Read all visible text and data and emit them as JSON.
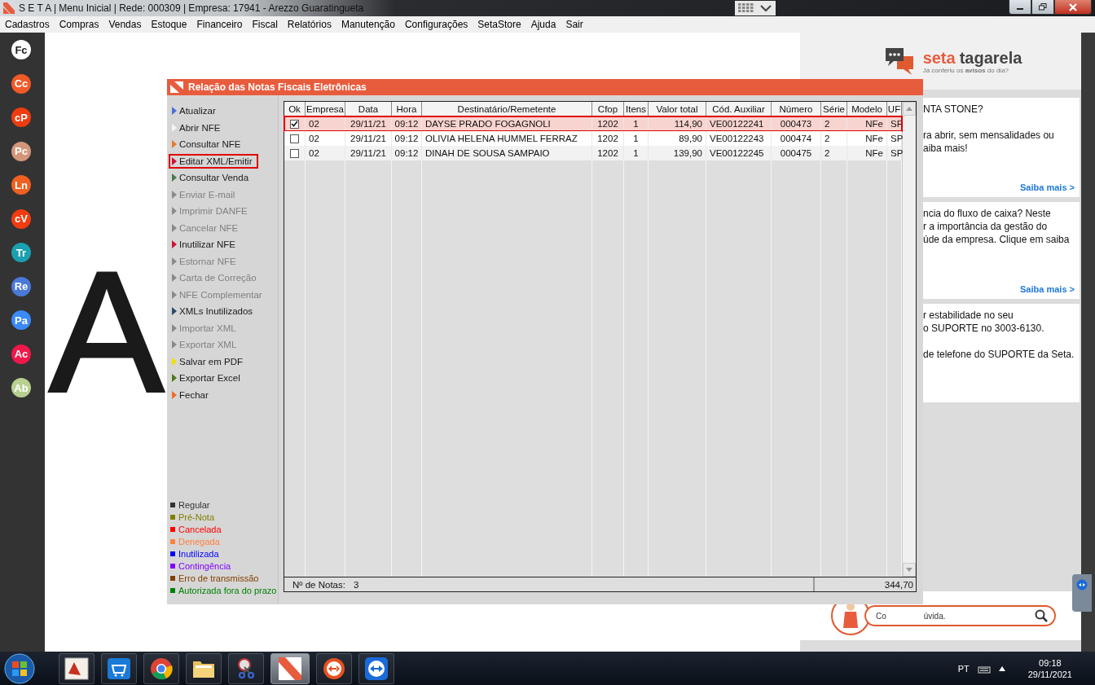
{
  "window": {
    "title": "S E T A | Menu Inicial | Rede: 000309 | Empresa: 17941 - Arezzo Guaratingueta"
  },
  "menu": [
    "Cadastros",
    "Compras",
    "Vendas",
    "Estoque",
    "Financeiro",
    "Fiscal",
    "Relatórios",
    "Manutenção",
    "Configurações",
    "SetaStore",
    "Ajuda",
    "Sair"
  ],
  "sidebar": {
    "items": [
      {
        "label": "Fc",
        "color": "#ffffff"
      },
      {
        "label": "Cc",
        "color": "#f05a28"
      },
      {
        "label": "cP",
        "color": "#f03c10"
      },
      {
        "label": "Pc",
        "color": "#d4967a"
      },
      {
        "label": "Ln",
        "color": "#f06020"
      },
      {
        "label": "cV",
        "color": "#f03c10"
      },
      {
        "label": "Tr",
        "color": "#1aa0b0"
      },
      {
        "label": "Re",
        "color": "#4a7ad8"
      },
      {
        "label": "Pa",
        "color": "#3a8af8"
      },
      {
        "label": "Ac",
        "color": "#f0184a"
      },
      {
        "label": "Ab",
        "color": "#b8d090"
      }
    ]
  },
  "background_logo": "A",
  "news": {
    "brand": "seta",
    "name": "tagarela",
    "tagline": "Já conferiu os **avisos** do dia?",
    "cards": [
      {
        "paragraphs": [
          [
            "NTA STONE?"
          ],
          [
            "ra abrir, sem mensalidades ou",
            "aiba mais!"
          ]
        ],
        "link": "Saiba mais >"
      },
      {
        "paragraphs": [
          [
            "ncia do fluxo de caixa?  Neste",
            "r a importância da gestão do",
            "úde da empresa. Clique em saiba"
          ]
        ],
        "link": "Saiba mais >"
      },
      {
        "paragraphs": [
          [
            "r estabilidade no seu",
            "o SUPORTE no 3003-6130."
          ],
          [
            "de telefone do SUPORTE da Seta."
          ]
        ]
      }
    ]
  },
  "help_search": {
    "text_start": "Co",
    "text_end": "úvida."
  },
  "dialog": {
    "title": "Relação das Notas Fiscais Eletrônicas",
    "actions": [
      {
        "label": "Atualizar",
        "color": "#4a6fd8",
        "disabled": false,
        "highlighted": false
      },
      {
        "label": "Abrir NFE",
        "color": "#f4f4f4",
        "disabled": false,
        "highlighted": false
      },
      {
        "label": "Consultar NFE",
        "color": "#e87a2c",
        "disabled": false,
        "highlighted": false
      },
      {
        "label": "Editar XML/Emitir",
        "color": "#d0103a",
        "disabled": false,
        "highlighted": true
      },
      {
        "label": "Consultar Venda",
        "color": "#4a7a4a",
        "disabled": false,
        "highlighted": false
      },
      {
        "label": "Enviar E-mail",
        "color": "#8a8a8a",
        "disabled": true,
        "highlighted": false
      },
      {
        "label": "Imprimir DANFE",
        "color": "#8a8a8a",
        "disabled": true,
        "highlighted": false
      },
      {
        "label": "Cancelar NFE",
        "color": "#8a8a8a",
        "disabled": true,
        "highlighted": false
      },
      {
        "label": "Inutilizar NFE",
        "color": "#d0103a",
        "disabled": false,
        "highlighted": false
      },
      {
        "label": "Estornar NFE",
        "color": "#8a8a8a",
        "disabled": true,
        "highlighted": false
      },
      {
        "label": "Carta de Correção",
        "color": "#8a8a8a",
        "disabled": true,
        "highlighted": false
      },
      {
        "label": "NFE Complementar",
        "color": "#8a8a8a",
        "disabled": true,
        "highlighted": false
      },
      {
        "label": "XMLs Inutilizados",
        "color": "#2c4a6a",
        "disabled": false,
        "highlighted": false
      },
      {
        "label": "Importar XML",
        "color": "#8a8a8a",
        "disabled": true,
        "highlighted": false
      },
      {
        "label": "Exportar XML",
        "color": "#8a8a8a",
        "disabled": true,
        "highlighted": false
      },
      {
        "label": "Salvar em PDF",
        "color": "#f0e000",
        "disabled": false,
        "highlighted": false
      },
      {
        "label": "Exportar Excel",
        "color": "#4a7a1a",
        "disabled": false,
        "highlighted": false
      },
      {
        "label": "Fechar",
        "color": "#f06a2a",
        "disabled": false,
        "highlighted": false
      }
    ],
    "legend": [
      {
        "label": "Regular",
        "color": "#333333"
      },
      {
        "label": "Pré-Nota",
        "color": "#808000"
      },
      {
        "label": "Cancelada",
        "color": "#ff0000"
      },
      {
        "label": "Denegada",
        "color": "#ff8040"
      },
      {
        "label": "Inutilizada",
        "color": "#0000ff"
      },
      {
        "label": "Contingência",
        "color": "#8000ff"
      },
      {
        "label": "Erro de transmissão",
        "color": "#804000"
      },
      {
        "label": "Autorizada fora do prazo",
        "color": "#008000"
      }
    ],
    "table": {
      "check_column": "Ok",
      "columns": [
        "Empresa",
        "Data",
        "Hora",
        "Destinatário/Remetente",
        "Cfop",
        "Itens",
        "Valor total",
        "Cód. Auxiliar",
        "Número",
        "Série",
        "Modelo",
        "UF"
      ],
      "rows": [
        {
          "checked": true,
          "selected": true,
          "cells": [
            "02",
            "29/11/21",
            "09:12",
            "DAYSE PRADO FOGAGNOLI",
            "1202",
            "1",
            "114,90",
            "VE00122241",
            "000473",
            "2",
            "NFe",
            "SP"
          ]
        },
        {
          "checked": false,
          "selected": false,
          "cells": [
            "02",
            "29/11/21",
            "09:12",
            "OLIVIA HELENA HUMMEL FERRAZ",
            "1202",
            "1",
            "89,90",
            "VE00122243",
            "000474",
            "2",
            "NFe",
            "SP"
          ]
        },
        {
          "checked": false,
          "selected": false,
          "cells": [
            "02",
            "29/11/21",
            "09:12",
            "DINAH DE SOUSA SAMPAIO",
            "1202",
            "1",
            "139,90",
            "VE00122245",
            "000475",
            "2",
            "NFe",
            "SP"
          ]
        }
      ]
    },
    "footer": {
      "count_label": "Nº de Notas:",
      "count": "3",
      "total": "344,70"
    }
  },
  "taskbar": {
    "items": [
      {
        "kind": "app3c",
        "active": false
      },
      {
        "kind": "basket",
        "active": false
      },
      {
        "kind": "chrome",
        "active": false
      },
      {
        "kind": "folder",
        "active": false
      },
      {
        "kind": "scissors",
        "active": false
      },
      {
        "kind": "seta",
        "active": true
      },
      {
        "kind": "arrows",
        "active": false
      },
      {
        "kind": "teamviewer",
        "active": false
      }
    ],
    "language": "PT",
    "time": "09:18",
    "date": "29/11/2021"
  }
}
